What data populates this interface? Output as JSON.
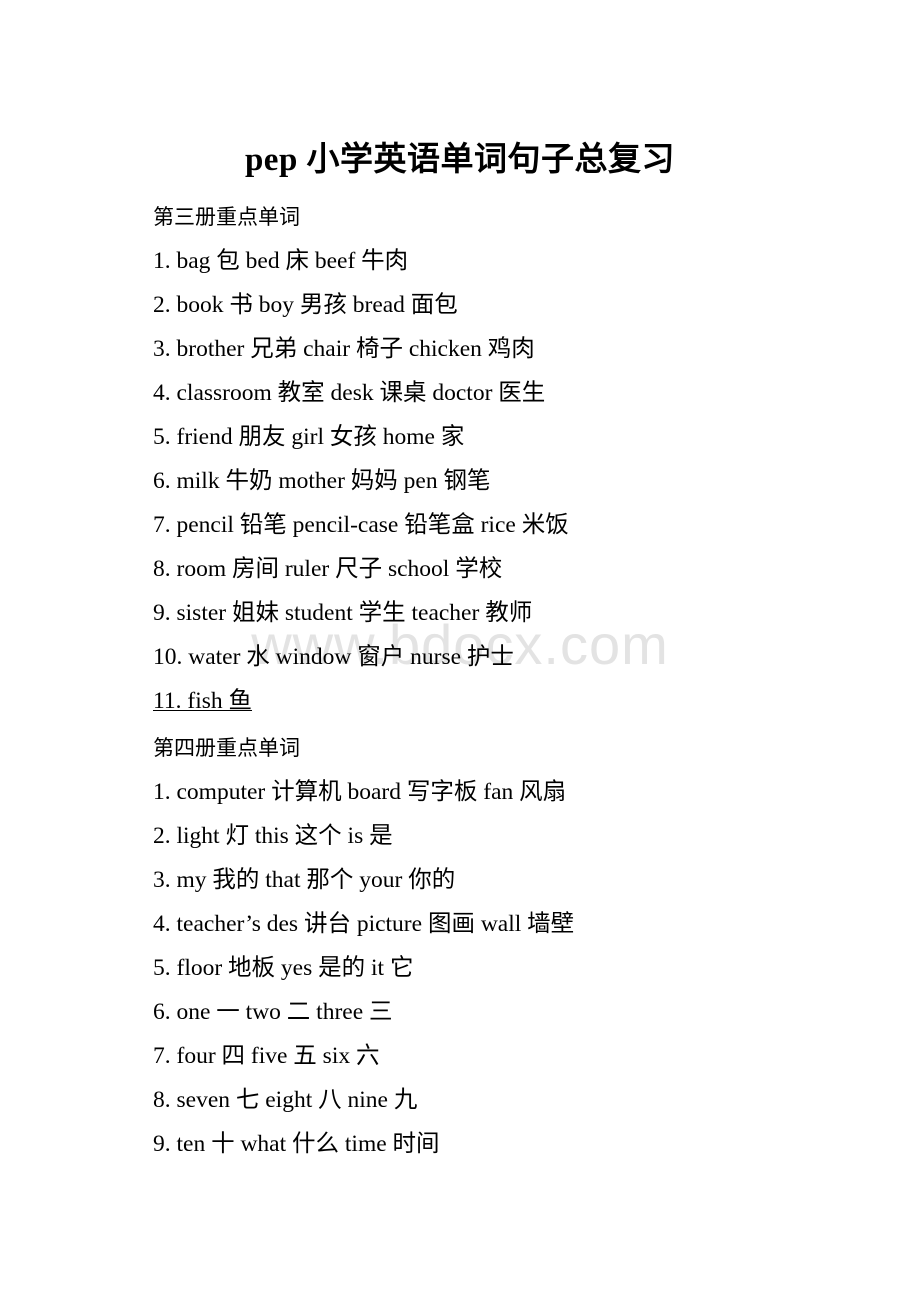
{
  "document": {
    "title": "pep 小学英语单词句子总复习",
    "watermark": "www.bdocx.com"
  },
  "sections": [
    {
      "header": "第三册重点单词",
      "lines": [
        "1. bag 包 bed 床 beef 牛肉",
        "2. book 书 boy 男孩 bread 面包",
        "3. brother 兄弟 chair 椅子 chicken 鸡肉",
        "4. classroom 教室 desk 课桌 doctor 医生",
        "5. friend 朋友 girl 女孩 home 家",
        "6. milk 牛奶 mother 妈妈 pen 钢笔",
        "7. pencil 铅笔 pencil-case 铅笔盒 rice 米饭",
        "8. room 房间 ruler 尺子 school 学校",
        "9. sister 姐妹 student 学生 teacher 教师",
        "10. water 水 window 窗户 nurse 护士",
        "11. fish 鱼"
      ]
    },
    {
      "header": "第四册重点单词",
      "lines": [
        "1. computer 计算机 board 写字板 fan 风扇",
        "2. light 灯 this 这个 is 是",
        "3. my 我的 that 那个 your 你的",
        "4. teacher’s des 讲台 picture 图画 wall 墙壁",
        "5. floor 地板 yes 是的 it 它",
        "6. one 一 two 二 three 三",
        "7. four 四 five 五 six 六",
        "8. seven 七 eight 八 nine 九",
        "9. ten 十 what 什么 time 时间"
      ]
    }
  ]
}
